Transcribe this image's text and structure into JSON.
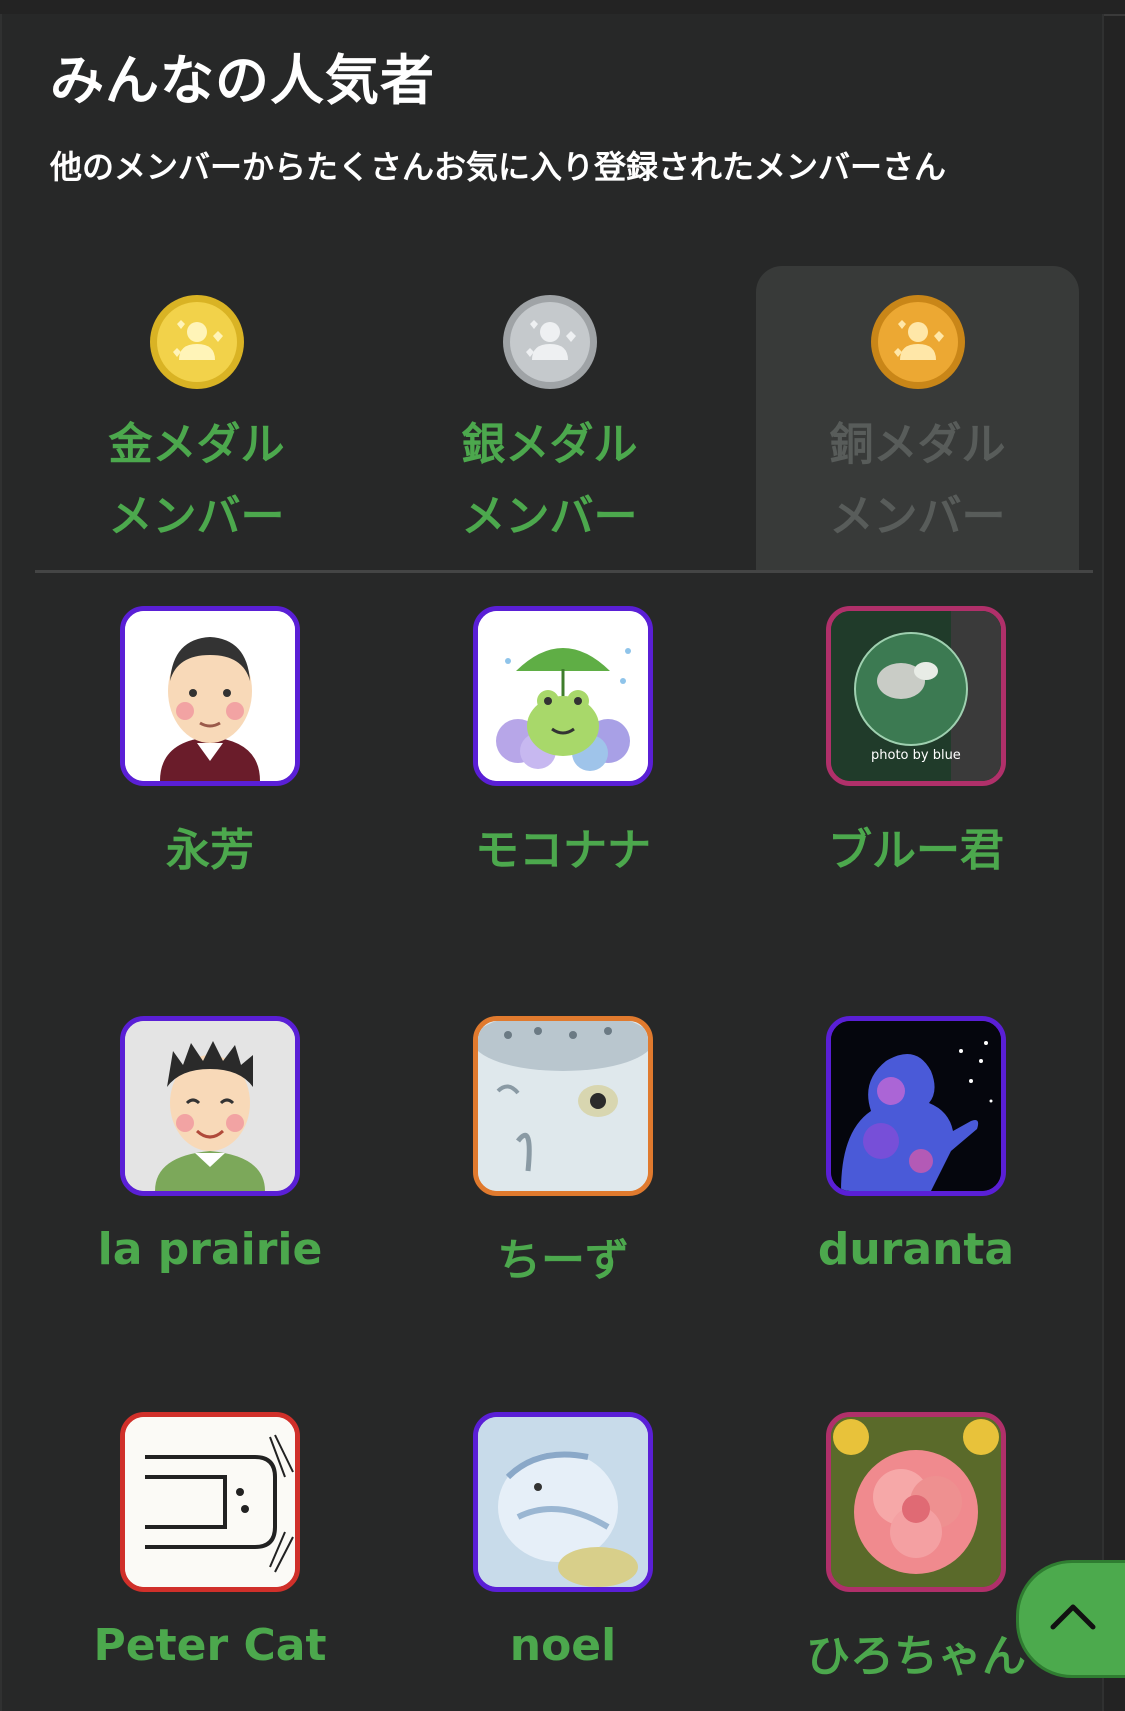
{
  "section": {
    "title": "みんなの人気者",
    "subtitle": "他のメンバーからたくさんお気に入り登録されたメンバーさん"
  },
  "tabs": [
    {
      "line1": "金メダル",
      "line2": "メンバー",
      "icon": "gold-medal-icon",
      "color": "#e6c53a",
      "active": false
    },
    {
      "line1": "銀メダル",
      "line2": "メンバー",
      "icon": "silver-medal-icon",
      "color": "#bfc3c6",
      "active": false
    },
    {
      "line1": "銅メダル",
      "line2": "メンバー",
      "icon": "bronze-medal-icon",
      "color": "#e3a22e",
      "active": true
    }
  ],
  "members": [
    {
      "name": "永芳",
      "avatar": "man-in-vest-avatar",
      "border": "#5a1fd6"
    },
    {
      "name": "モコナナ",
      "avatar": "frog-umbrella-avatar",
      "border": "#5a1fd6"
    },
    {
      "name": "ブルー君",
      "avatar": "crystal-ball-photo-avatar",
      "border": "#b0306a",
      "photo_caption": "photo by blue"
    },
    {
      "name": "la prairie",
      "avatar": "smiling-man-avatar",
      "border": "#5a1fd6"
    },
    {
      "name": "ちーず",
      "avatar": "snowy-owl-avatar",
      "border": "#e07a2e"
    },
    {
      "name": "duranta",
      "avatar": "galaxy-silhouette-avatar",
      "border": "#5a1fd6"
    },
    {
      "name": "Peter Cat",
      "avatar": "cat-drawing-avatar",
      "border": "#d0302a"
    },
    {
      "name": "noel",
      "avatar": "white-bird-avatar",
      "border": "#5a1fd6"
    },
    {
      "name": "ひろちゃん",
      "avatar": "pink-carnation-avatar",
      "border": "#b0306a"
    }
  ],
  "colors": {
    "accent_green": "#4ca84d",
    "background": "#272828",
    "active_tab": "#383a39"
  },
  "scroll_top": {
    "icon": "chevron-up-icon"
  }
}
